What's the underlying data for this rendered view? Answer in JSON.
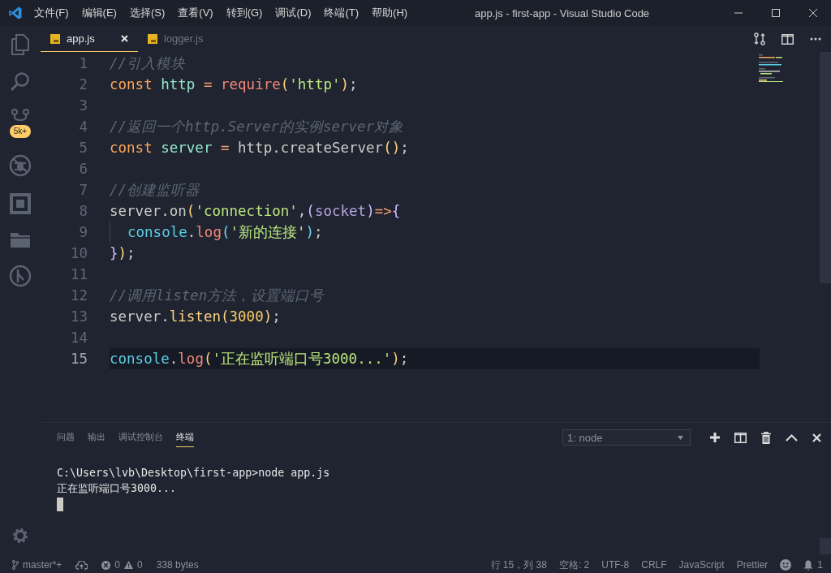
{
  "window": {
    "title": "app.js - first-app - Visual Studio Code"
  },
  "menu": [
    "文件(F)",
    "编辑(E)",
    "选择(S)",
    "查看(V)",
    "转到(G)",
    "调试(D)",
    "终端(T)",
    "帮助(H)"
  ],
  "activity_bar": {
    "source_control_badge": "5k+"
  },
  "tabs": [
    {
      "label": "app.js",
      "selected": true
    },
    {
      "label": "logger.js",
      "selected": false
    }
  ],
  "editor": {
    "lines": [
      {
        "number": "1",
        "current": false,
        "indented": false,
        "tokens": [
          {
            "text": "//引入模块",
            "kind": "comment"
          }
        ]
      },
      {
        "number": "2",
        "current": false,
        "indented": false,
        "tokens": [
          {
            "text": "const ",
            "kind": "keyword"
          },
          {
            "text": "http",
            "kind": "variable"
          },
          {
            "text": " = ",
            "kind": "operator"
          },
          {
            "text": "require",
            "kind": "call"
          },
          {
            "text": "(",
            "kind": "paren"
          },
          {
            "text": "'http'",
            "kind": "string"
          },
          {
            "text": ")",
            "kind": "paren"
          },
          {
            "text": ";",
            "kind": "plain"
          }
        ]
      },
      {
        "number": "3",
        "current": false,
        "indented": false
      },
      {
        "number": "4",
        "current": false,
        "indented": false,
        "tokens": [
          {
            "text": "//返回一个http.Server的实例server对象",
            "kind": "comment"
          }
        ]
      },
      {
        "number": "5",
        "current": false,
        "indented": false,
        "tokens": [
          {
            "text": "const ",
            "kind": "keyword"
          },
          {
            "text": "server",
            "kind": "variable"
          },
          {
            "text": " = ",
            "kind": "operator"
          },
          {
            "text": "http.createServer",
            "kind": "plain"
          },
          {
            "text": "()",
            "kind": "paren"
          },
          {
            "text": ";",
            "kind": "plain"
          }
        ]
      },
      {
        "number": "6",
        "current": false,
        "indented": false
      },
      {
        "number": "7",
        "current": false,
        "indented": false,
        "tokens": [
          {
            "text": "//创建监听器",
            "kind": "comment"
          }
        ]
      },
      {
        "number": "8",
        "current": false,
        "indented": false,
        "tokens": [
          {
            "text": "server.on",
            "kind": "plain"
          },
          {
            "text": "(",
            "kind": "paren"
          },
          {
            "text": "'connection'",
            "kind": "string"
          },
          {
            "text": ",",
            "kind": "plain"
          },
          {
            "text": "(",
            "kind": "bracket"
          },
          {
            "text": "socket",
            "kind": "param"
          },
          {
            "text": ")",
            "kind": "bracket"
          },
          {
            "text": "=>",
            "kind": "operator"
          },
          {
            "text": "{",
            "kind": "bracket"
          }
        ]
      },
      {
        "number": "9",
        "current": false,
        "indented": true,
        "tokens": [
          {
            "text": "console",
            "kind": "object"
          },
          {
            "text": ".",
            "kind": "plain"
          },
          {
            "text": "log",
            "kind": "call"
          },
          {
            "text": "(",
            "kind": "bracket2"
          },
          {
            "text": "'新的连接'",
            "kind": "string"
          },
          {
            "text": ")",
            "kind": "bracket2"
          },
          {
            "text": ";",
            "kind": "plain"
          }
        ]
      },
      {
        "number": "10",
        "current": false,
        "indented": false,
        "tokens": [
          {
            "text": "}",
            "kind": "bracket"
          },
          {
            "text": ")",
            "kind": "paren"
          },
          {
            "text": ";",
            "kind": "plain"
          }
        ]
      },
      {
        "number": "11",
        "current": false,
        "indented": false
      },
      {
        "number": "12",
        "current": false,
        "indented": false,
        "tokens": [
          {
            "text": "//调用listen方法，设置端口号",
            "kind": "comment"
          }
        ]
      },
      {
        "number": "13",
        "current": false,
        "indented": false,
        "tokens": [
          {
            "text": "server.",
            "kind": "plain"
          },
          {
            "text": "listen",
            "kind": "method"
          },
          {
            "text": "(",
            "kind": "paren"
          },
          {
            "text": "3000",
            "kind": "number"
          },
          {
            "text": ")",
            "kind": "paren"
          },
          {
            "text": ";",
            "kind": "plain"
          }
        ]
      },
      {
        "number": "14",
        "current": false,
        "indented": false
      },
      {
        "number": "15",
        "current": true,
        "indented": false,
        "tokens": [
          {
            "text": "console",
            "kind": "object"
          },
          {
            "text": ".",
            "kind": "plain"
          },
          {
            "text": "log",
            "kind": "call"
          },
          {
            "text": "(",
            "kind": "paren"
          },
          {
            "text": "'正在监听端口号3000...'",
            "kind": "string"
          },
          {
            "text": ")",
            "kind": "paren"
          },
          {
            "text": ";",
            "kind": "plain"
          }
        ]
      }
    ]
  },
  "panel": {
    "tabs": [
      {
        "label": "问题",
        "selected": false
      },
      {
        "label": "输出",
        "selected": false
      },
      {
        "label": "调试控制台",
        "selected": false
      },
      {
        "label": "终端",
        "selected": true
      }
    ],
    "terminal_select": "1: node",
    "terminal_lines": [
      "C:\\Users\\lvb\\Desktop\\first-app>node app.js",
      "正在监听端口号3000..."
    ]
  },
  "status_bar": {
    "branch": "master*+",
    "errors": "0",
    "warnings": "0",
    "size": "338 bytes",
    "position": "行 15，列 38",
    "indent": "空格: 2",
    "encoding": "UTF-8",
    "eol": "CRLF",
    "language": "JavaScript",
    "formatter": "Prettier",
    "notifications": "1"
  }
}
